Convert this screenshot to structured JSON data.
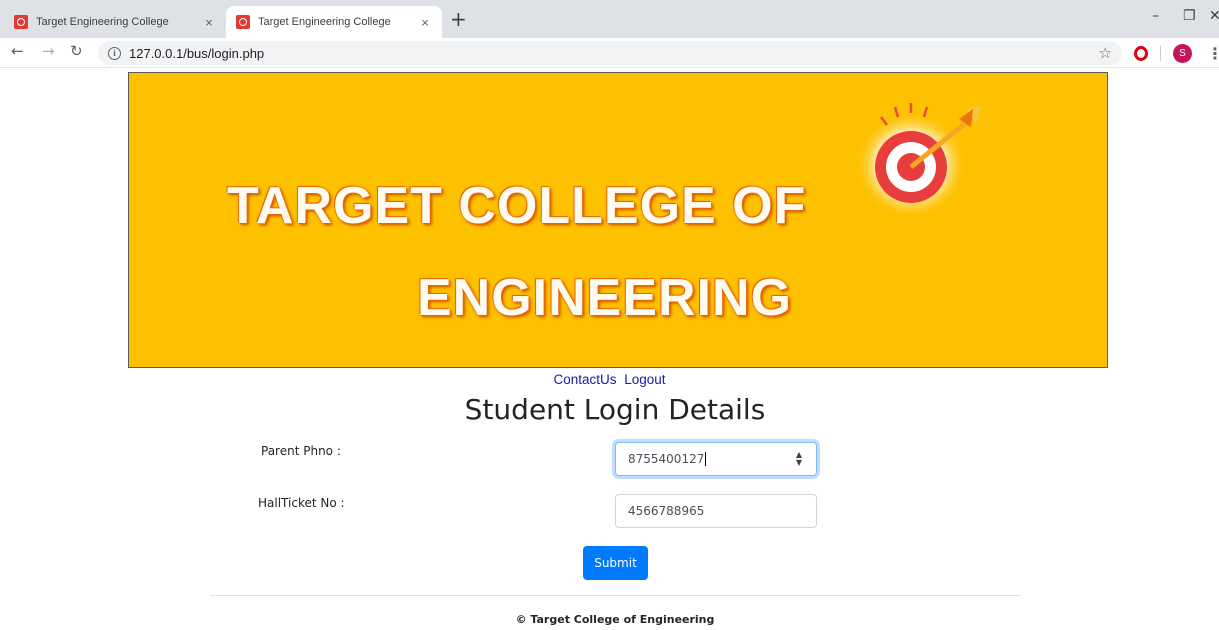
{
  "browser": {
    "tabs": [
      {
        "title": "Target Engineering College",
        "active": false
      },
      {
        "title": "Target Engineering College",
        "active": true
      }
    ],
    "new_tab": "+",
    "close_glyph": "×",
    "url": "127.0.0.1/bus/login.php",
    "avatar_letter": "S",
    "icons": [
      "back-arrow-icon",
      "forward-arrow-icon",
      "reload-icon",
      "info-icon",
      "star-icon",
      "opera-icon",
      "menu-icon"
    ]
  },
  "banner": {
    "line1": "TARGET COLLEGE OF",
    "line2": "ENGINEERING",
    "background_color": "#fec100"
  },
  "nav": {
    "contact": "ContactUs",
    "logout": "Logout"
  },
  "form": {
    "title": "Student Login Details",
    "parent_phone_label": "Parent Phno :",
    "parent_phone_value": "8755400127",
    "hallticket_label": "HallTicket No :",
    "hallticket_value": "4566788965",
    "submit_label": "Submit",
    "accent_color": "#007bff"
  },
  "footer": {
    "text": "© Target College of Engineering"
  }
}
